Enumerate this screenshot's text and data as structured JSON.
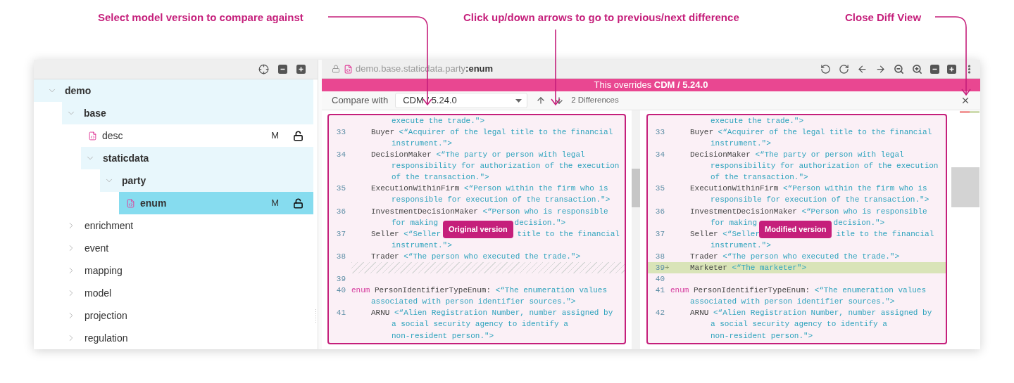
{
  "annotations": [
    {
      "text": "Select model version to compare against"
    },
    {
      "text": "Click up/down arrows to go to previous/next difference"
    },
    {
      "text": "Close Diff View"
    }
  ],
  "explorer": {
    "tree": [
      {
        "label": "demo",
        "kind": "folder",
        "expanded": true,
        "selected": false,
        "children": [
          {
            "label": "base",
            "kind": "folder",
            "expanded": true,
            "selected": false,
            "children": [
              {
                "label": "desc",
                "kind": "file",
                "selected": false,
                "status": "M"
              },
              {
                "label": "staticdata",
                "kind": "folder",
                "expanded": true,
                "selected": false,
                "children": [
                  {
                    "label": "party",
                    "kind": "folder",
                    "expanded": true,
                    "selected": false,
                    "children": [
                      {
                        "label": "enum",
                        "kind": "file",
                        "selected": true,
                        "status": "M"
                      }
                    ]
                  }
                ]
              }
            ]
          },
          {
            "label": "enrichment",
            "kind": "folder",
            "expanded": false,
            "selected": false
          },
          {
            "label": "event",
            "kind": "folder",
            "expanded": false,
            "selected": false
          },
          {
            "label": "mapping",
            "kind": "folder",
            "expanded": false,
            "selected": false
          },
          {
            "label": "model",
            "kind": "folder",
            "expanded": false,
            "selected": false
          },
          {
            "label": "projection",
            "kind": "folder",
            "expanded": false,
            "selected": false
          },
          {
            "label": "regulation",
            "kind": "folder",
            "expanded": false,
            "selected": false
          }
        ]
      }
    ]
  },
  "editor": {
    "breadcrumb": "demo.base.staticdata.party**:enum**",
    "banner": "This overrides **CDM / 5.24.0**",
    "compare": {
      "label": "Compare with",
      "value": "CDM / 5.24.0",
      "differences": "2 Differences"
    },
    "panes": [
      {
        "badge": "Original version",
        "lines": [
          {
            "kind": "member-wrap",
            "segments": [
              {
                "kind": "doc",
                "text": "execute the trade.\">"
              }
            ]
          },
          {
            "kind": "member",
            "number": "33",
            "segments": [
              {
                "kind": "name",
                "text": "Buyer"
              },
              {
                "kind": "doc",
                "text": "<“Acquirer of the legal title to the financial"
              }
            ]
          },
          {
            "kind": "member-wrap",
            "segments": [
              {
                "kind": "doc",
                "text": "instrument.\">"
              }
            ]
          },
          {
            "kind": "member",
            "number": "34",
            "segments": [
              {
                "kind": "name",
                "text": "DecisionMaker"
              },
              {
                "kind": "doc",
                "text": "<“The party or person with legal"
              }
            ]
          },
          {
            "kind": "member-wrap",
            "segments": [
              {
                "kind": "doc",
                "text": "responsibility for authorization of the execution"
              }
            ]
          },
          {
            "kind": "member-wrap",
            "segments": [
              {
                "kind": "doc",
                "text": "of the transaction.\">"
              }
            ]
          },
          {
            "kind": "member",
            "number": "35",
            "segments": [
              {
                "kind": "name",
                "text": "ExecutionWithinFirm"
              },
              {
                "kind": "doc",
                "text": "<“Person within the firm who is"
              }
            ]
          },
          {
            "kind": "member-wrap",
            "segments": [
              {
                "kind": "doc",
                "text": "responsible for execution of the transaction.\">"
              }
            ]
          },
          {
            "kind": "member",
            "number": "36",
            "segments": [
              {
                "kind": "name",
                "text": "InvestmentDecisionMaker"
              },
              {
                "kind": "doc",
                "text": "<“Person who is responsible"
              }
            ]
          },
          {
            "kind": "member-wrap",
            "segments": [
              {
                "kind": "doc",
                "text": "for making"
              },
              {
                "kind": "gap"
              },
              {
                "kind": "doc",
                "text": "decision.\">"
              }
            ]
          },
          {
            "kind": "member",
            "number": "37",
            "segments": [
              {
                "kind": "name",
                "text": "Seller"
              },
              {
                "kind": "doc",
                "text": "<“Seller"
              },
              {
                "kind": "gap"
              },
              {
                "kind": "doc",
                "text": "title to the financial"
              }
            ]
          },
          {
            "kind": "member-wrap",
            "segments": [
              {
                "kind": "doc",
                "text": "instrument.\">"
              }
            ]
          },
          {
            "kind": "member",
            "number": "38",
            "segments": [
              {
                "kind": "name",
                "text": "Trader"
              },
              {
                "kind": "doc",
                "text": "<“The person who executed the trade.\">"
              }
            ]
          },
          {
            "kind": "hatch"
          },
          {
            "kind": "blank",
            "number": "39"
          },
          {
            "kind": "decl",
            "number": "40",
            "segments": [
              {
                "kind": "keyword",
                "text": "enum"
              },
              {
                "kind": "name",
                "text": "PersonIdentifierTypeEnum:"
              },
              {
                "kind": "doc",
                "text": "<“The enumeration values"
              }
            ]
          },
          {
            "kind": "decl-wrap",
            "segments": [
              {
                "kind": "doc",
                "text": "associated with person identifier sources.\">"
              }
            ]
          },
          {
            "kind": "member",
            "number": "41",
            "segments": [
              {
                "kind": "name",
                "text": "ARNU"
              },
              {
                "kind": "doc",
                "text": "<“Alien Registration Number, number assigned by"
              }
            ]
          },
          {
            "kind": "member-wrap",
            "segments": [
              {
                "kind": "doc",
                "text": "a social security agency to identify a"
              }
            ]
          },
          {
            "kind": "member-wrap",
            "segments": [
              {
                "kind": "doc",
                "text": "non-resident person.\">"
              }
            ]
          }
        ]
      },
      {
        "badge": "Modified version",
        "lines": [
          {
            "kind": "member-wrap",
            "segments": [
              {
                "kind": "doc",
                "text": "execute the trade.\">"
              }
            ]
          },
          {
            "kind": "member",
            "number": "33",
            "segments": [
              {
                "kind": "name",
                "text": "Buyer"
              },
              {
                "kind": "doc",
                "text": "<“Acquirer of the legal title to the financial"
              }
            ]
          },
          {
            "kind": "member-wrap",
            "segments": [
              {
                "kind": "doc",
                "text": "instrument.\">"
              }
            ]
          },
          {
            "kind": "member",
            "number": "34",
            "segments": [
              {
                "kind": "name",
                "text": "DecisionMaker"
              },
              {
                "kind": "doc",
                "text": "<“The party or person with legal"
              }
            ]
          },
          {
            "kind": "member-wrap",
            "segments": [
              {
                "kind": "doc",
                "text": "responsibility for authorization of the execution"
              }
            ]
          },
          {
            "kind": "member-wrap",
            "segments": [
              {
                "kind": "doc",
                "text": "of the transaction.\">"
              }
            ]
          },
          {
            "kind": "member",
            "number": "35",
            "segments": [
              {
                "kind": "name",
                "text": "ExecutionWithinFirm"
              },
              {
                "kind": "doc",
                "text": "<“Person within the firm who is"
              }
            ]
          },
          {
            "kind": "member-wrap",
            "segments": [
              {
                "kind": "doc",
                "text": "responsible for execution of the transaction.\">"
              }
            ]
          },
          {
            "kind": "member",
            "number": "36",
            "segments": [
              {
                "kind": "name",
                "text": "InvestmentDecisionMaker"
              },
              {
                "kind": "doc",
                "text": "<“Person who is responsible"
              }
            ]
          },
          {
            "kind": "member-wrap",
            "segments": [
              {
                "kind": "doc",
                "text": "for making"
              },
              {
                "kind": "gap"
              },
              {
                "kind": "doc",
                "text": "decision.\">"
              }
            ]
          },
          {
            "kind": "member",
            "number": "37",
            "segments": [
              {
                "kind": "name",
                "text": "Seller"
              },
              {
                "kind": "doc",
                "text": "<“Seller"
              },
              {
                "kind": "gap"
              },
              {
                "kind": "doc",
                "text": "itle to the financial"
              }
            ]
          },
          {
            "kind": "member-wrap",
            "segments": [
              {
                "kind": "doc",
                "text": "instrument.\">"
              }
            ]
          },
          {
            "kind": "member",
            "number": "38",
            "segments": [
              {
                "kind": "name",
                "text": "Trader"
              },
              {
                "kind": "doc",
                "text": "<“The person who executed the trade.\">"
              }
            ]
          },
          {
            "kind": "added",
            "number": "39",
            "marker": "+",
            "segments": [
              {
                "kind": "name",
                "text": "Marketer"
              },
              {
                "kind": "doc",
                "text": "<“The marketer\">"
              }
            ]
          },
          {
            "kind": "blank",
            "number": "40"
          },
          {
            "kind": "decl",
            "number": "41",
            "segments": [
              {
                "kind": "keyword",
                "text": "enum"
              },
              {
                "kind": "name",
                "text": "PersonIdentifierTypeEnum:"
              },
              {
                "kind": "doc",
                "text": "<“The enumeration values"
              }
            ]
          },
          {
            "kind": "decl-wrap",
            "segments": [
              {
                "kind": "doc",
                "text": "associated with person identifier sources.\">"
              }
            ]
          },
          {
            "kind": "member",
            "number": "42",
            "segments": [
              {
                "kind": "name",
                "text": "ARNU"
              },
              {
                "kind": "doc",
                "text": "<“Alien Registration Number, number assigned by"
              }
            ]
          },
          {
            "kind": "member-wrap",
            "segments": [
              {
                "kind": "doc",
                "text": "a social security agency to identify a"
              }
            ]
          },
          {
            "kind": "member-wrap",
            "segments": [
              {
                "kind": "doc",
                "text": "non-resident person.\">"
              }
            ]
          }
        ]
      }
    ]
  }
}
